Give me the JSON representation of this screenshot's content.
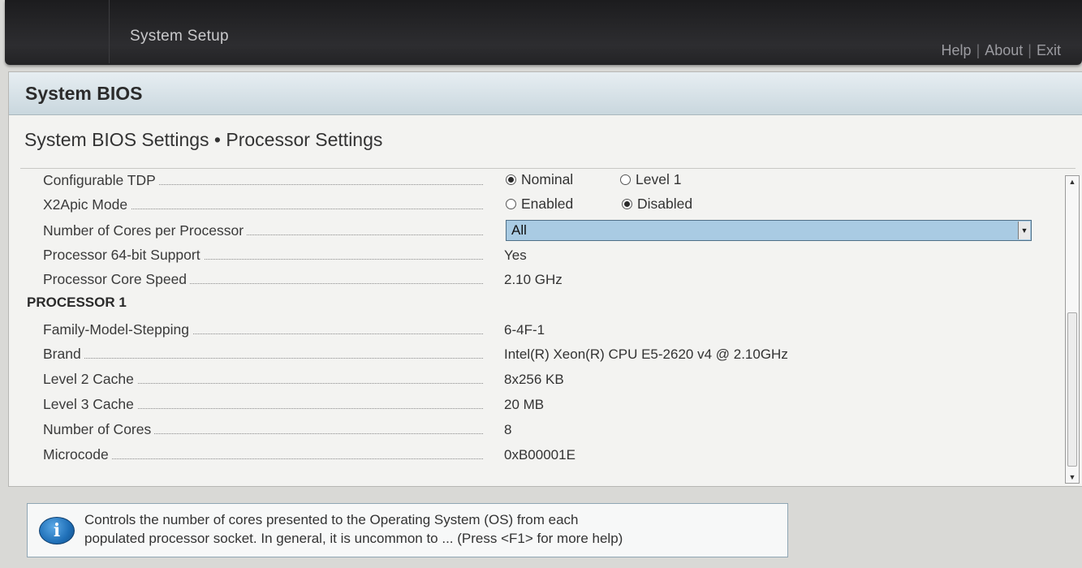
{
  "header": {
    "app_title": "System Setup",
    "links": [
      "Help",
      "About",
      "Exit"
    ],
    "separator": "|"
  },
  "section": {
    "title": "System BIOS",
    "subtitle": "System BIOS Settings • Processor Settings"
  },
  "settings": {
    "configurable_tdp": {
      "label": "Configurable TDP",
      "options": [
        {
          "label": "Nominal",
          "selected": true
        },
        {
          "label": "Level 1",
          "selected": false
        }
      ]
    },
    "x2apic_mode": {
      "label": "X2Apic Mode",
      "options": [
        {
          "label": "Enabled",
          "selected": false
        },
        {
          "label": "Disabled",
          "selected": true
        }
      ]
    },
    "cores_per_processor": {
      "label": "Number of Cores per Processor",
      "value": "All"
    },
    "processor_64bit": {
      "label": "Processor 64-bit Support",
      "value": "Yes"
    },
    "core_speed": {
      "label": "Processor Core Speed",
      "value": "2.10 GHz"
    }
  },
  "processor1": {
    "heading": "PROCESSOR 1",
    "rows": [
      {
        "label": "Family-Model-Stepping",
        "value": "6-4F-1"
      },
      {
        "label": "Brand",
        "value": "Intel(R) Xeon(R) CPU E5-2620 v4 @ 2.10GHz"
      },
      {
        "label": "Level 2 Cache",
        "value": "8x256 KB"
      },
      {
        "label": "Level 3 Cache",
        "value": "20 MB"
      },
      {
        "label": "Number of Cores",
        "value": "8"
      },
      {
        "label": "Microcode",
        "value": "0xB00001E"
      }
    ]
  },
  "help": {
    "icon": "info-icon",
    "line1": "Controls the number of cores presented to the Operating System (OS) from each",
    "line2": "populated processor socket. In general, it is uncommon to ... (Press <F1> for more help)"
  }
}
